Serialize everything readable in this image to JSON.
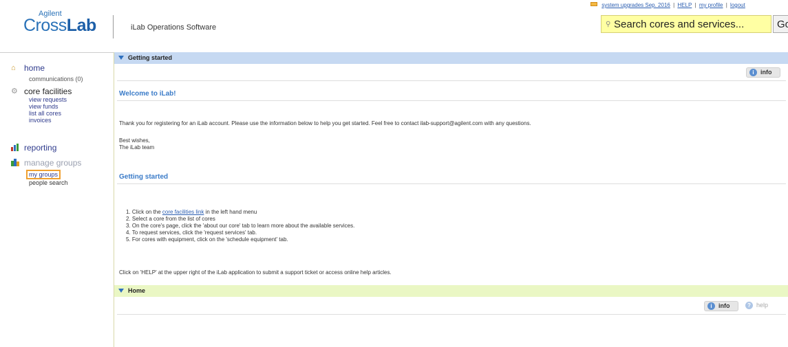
{
  "header": {
    "brand_small": "Agilent",
    "brand_light": "Cross",
    "brand_bold": "Lab",
    "app_title": "iLab Operations Software",
    "links": [
      "system upgrades Sep. 2016",
      "HELP",
      "my profile",
      "logout"
    ],
    "search_placeholder": "Search cores and services...",
    "go_label": "Go"
  },
  "sidebar": {
    "home": {
      "label": "home",
      "sub": "communications (0)"
    },
    "core": {
      "label": "core facilities",
      "items": [
        "view requests",
        "view funds",
        "list all cores",
        "invoices"
      ]
    },
    "reporting": {
      "label": "reporting"
    },
    "manage": {
      "label": "manage groups",
      "items": [
        "my groups",
        "people search"
      ]
    }
  },
  "main": {
    "getting_started_panel": {
      "title": "Getting started",
      "info_label": "info",
      "welcome_heading": "Welcome to iLab!",
      "intro": "Thank you for registering for an iLab account. Please use the information below to help you get started. Feel free to contact ilab-support@agilent.com with any questions.",
      "signoff_1": "Best wishes,",
      "signoff_2": "The iLab team",
      "section_heading": "Getting started",
      "step1_prefix": "1. Click on the ",
      "step1_link": "core facilities link",
      "step1_suffix": " in the left hand menu",
      "steps": [
        "2. Select a core from the list of cores",
        "3. On the core's page, click the 'about our core' tab to learn more about the available services.",
        "4. To request services, click the 'request services' tab.",
        "5. For cores with equipment, click on the 'schedule equipment' tab."
      ],
      "help_note": "Click on 'HELP' at the upper right of the iLab application to submit a support ticket or access online help articles."
    },
    "home_panel": {
      "title": "Home",
      "info_label": "info",
      "help_label": "help"
    }
  }
}
